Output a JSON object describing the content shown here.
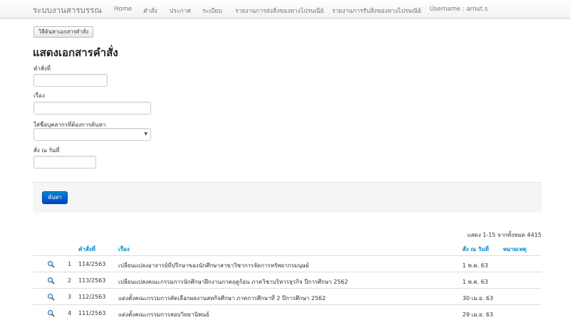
{
  "navbar": {
    "brand": "ระบบงานสารบรรณ",
    "items": [
      "Home",
      "คำสั่ง",
      "ประกาศ",
      "ระเบียบ",
      "รายงานการส่งสิ่งของทางไปรษณีย์",
      "รายงานการรับสิ่งของทางไปรษณีย์",
      "Username : arnut.s"
    ]
  },
  "search_guide_button": "วิธีค้นหาเอกสารคำสั่ง",
  "page_title": "แสดงเอกสารคำสั่ง",
  "form": {
    "order_no_label": "คำสั่งที่",
    "subject_label": "เรื่อง",
    "person_label": "ใส่ชื่อบุคลากรที่ต้องการค้นหา",
    "date_label": "สั่ง ณ วันที่",
    "order_no_value": "",
    "subject_value": "",
    "person_value": "",
    "date_value": "",
    "submit": "ค้นหา"
  },
  "summary": "แสดง 1-15 จากทั้งหมด 4415",
  "table": {
    "headers": {
      "order_no": "คำสั่งที่",
      "subject": "เรื่อง",
      "date": "สั่ง ณ วันที่",
      "note": "หมายเหตุ"
    },
    "rows": [
      {
        "index": "1",
        "order_no": "114/2563",
        "subject": "เปลี่ยนแปลงอาจารย์ที่ปรึกษาของนักศึกษาสาขาวิชาการจัดการทรัพยากรมนุษย์",
        "date": "1 พ.ค. 63",
        "note": ""
      },
      {
        "index": "2",
        "order_no": "113/2563",
        "subject": "เปลี่ยนแปลงคณะกรรมการนักศึกษาฝึกงานภาคฤดูร้อน ภาควิชาบริหารธุรกิจ ปีการศึกษา 2562",
        "date": "1 พ.ค. 63",
        "note": ""
      },
      {
        "index": "3",
        "order_no": "112/2563",
        "subject": "แต่งตั้งคณะกรรมการคัดเลือกผลงานสหกิจศึกษา ภาคการศึกษาที่ 2 ปีการศึกษา 2562",
        "date": "30 เม.ย. 63",
        "note": ""
      },
      {
        "index": "4",
        "order_no": "111/2563",
        "subject": "แต่งตั้งคณะกรรมการสอบวิทยานิพนธ์",
        "date": "29 เม.ย. 63",
        "note": ""
      }
    ]
  },
  "icons": {
    "row_action": "magnifier-icon",
    "select_arrow": "caret-down-icon"
  },
  "colors": {
    "link": "#0088cc",
    "primary_button": "#0055cc"
  }
}
